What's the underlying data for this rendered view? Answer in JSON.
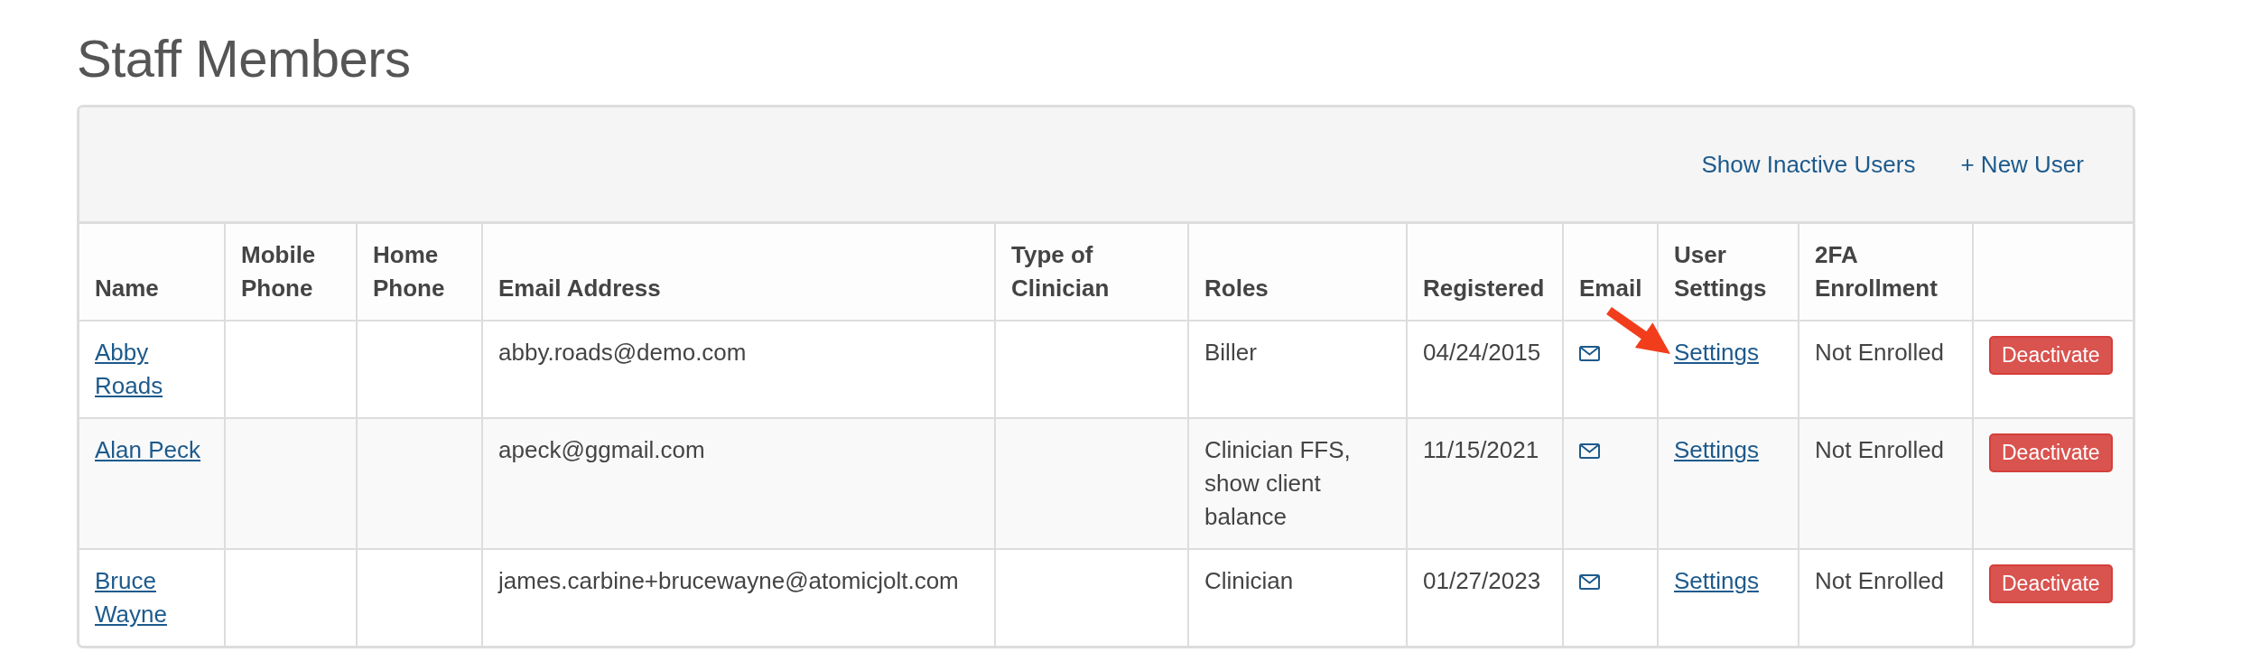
{
  "page": {
    "title": "Staff Members"
  },
  "panel": {
    "links": [
      {
        "label": "Show Inactive Users"
      },
      {
        "label": "+ New User"
      }
    ]
  },
  "table": {
    "columns": [
      "Name",
      "Mobile Phone",
      "Home Phone",
      "Email Address",
      "Type of Clinician",
      "Roles",
      "Registered",
      "Email",
      "User Settings",
      "2FA Enrollment"
    ],
    "rows": [
      {
        "name": "Abby Roads",
        "email_address": "abby.roads@demo.com",
        "roles": "Biller",
        "registered": "04/24/2015",
        "user_settings": "Settings",
        "enrollment": "Not Enrolled",
        "action": "Deactivate"
      },
      {
        "name": "Alan Peck",
        "email_address": "apeck@ggmail.com",
        "roles": "Clinician FFS, show client balance",
        "registered": "11/15/2021",
        "user_settings": "Settings",
        "enrollment": "Not Enrolled",
        "action": "Deactivate"
      },
      {
        "name": "Bruce Wayne",
        "email_address": "james.carbine+brucewayne@atomicjolt.com",
        "roles": "Clinician",
        "registered": "01/27/2023",
        "user_settings": "Settings",
        "enrollment": "Not Enrolled",
        "action": "Deactivate"
      }
    ]
  }
}
